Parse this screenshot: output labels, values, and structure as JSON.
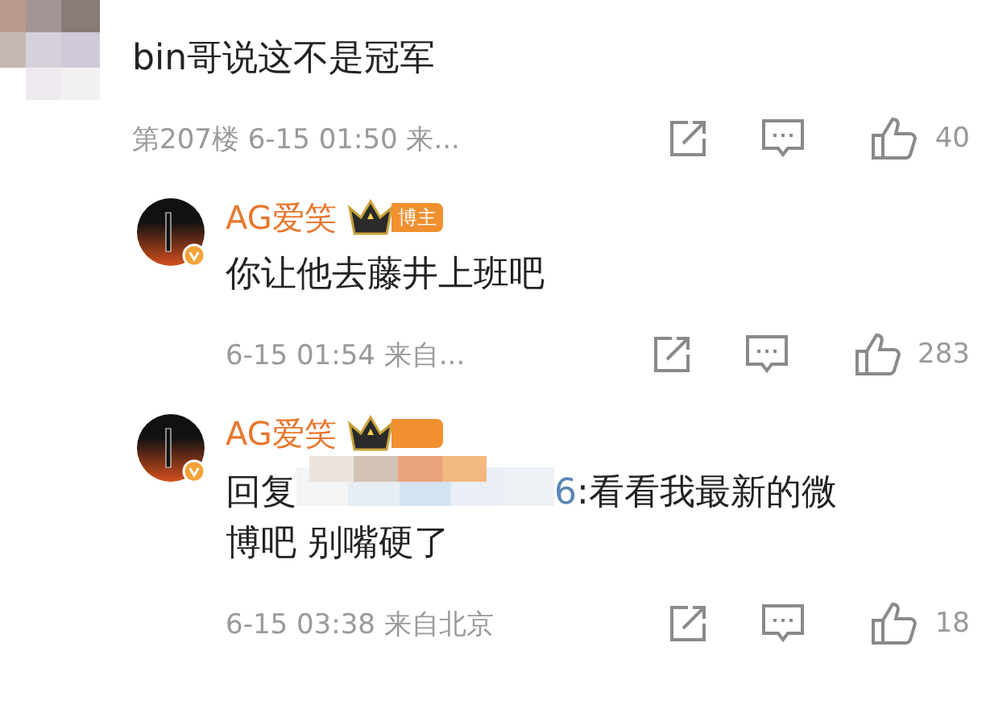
{
  "comments": [
    {
      "kind": "top",
      "text": "bin哥说这不是冠军",
      "floor": "第207楼",
      "time": "6-15 01:50",
      "source": "来...",
      "likes": "40"
    },
    {
      "kind": "reply",
      "author": "AG爱笑",
      "verified": true,
      "badge": "博主",
      "redacted": false,
      "text": "你让他去藤井上班吧",
      "time": "6-15 01:54",
      "source": "来自...",
      "likes": "283"
    },
    {
      "kind": "reply",
      "author": "AG爱笑",
      "verified": true,
      "redacted": true,
      "reply_prefix": "回复",
      "mention": "6",
      "text": ":看看我最新的微博吧 别嘴硬了",
      "time": "6-15 03:38",
      "source": "来自北京",
      "likes": "18"
    }
  ]
}
